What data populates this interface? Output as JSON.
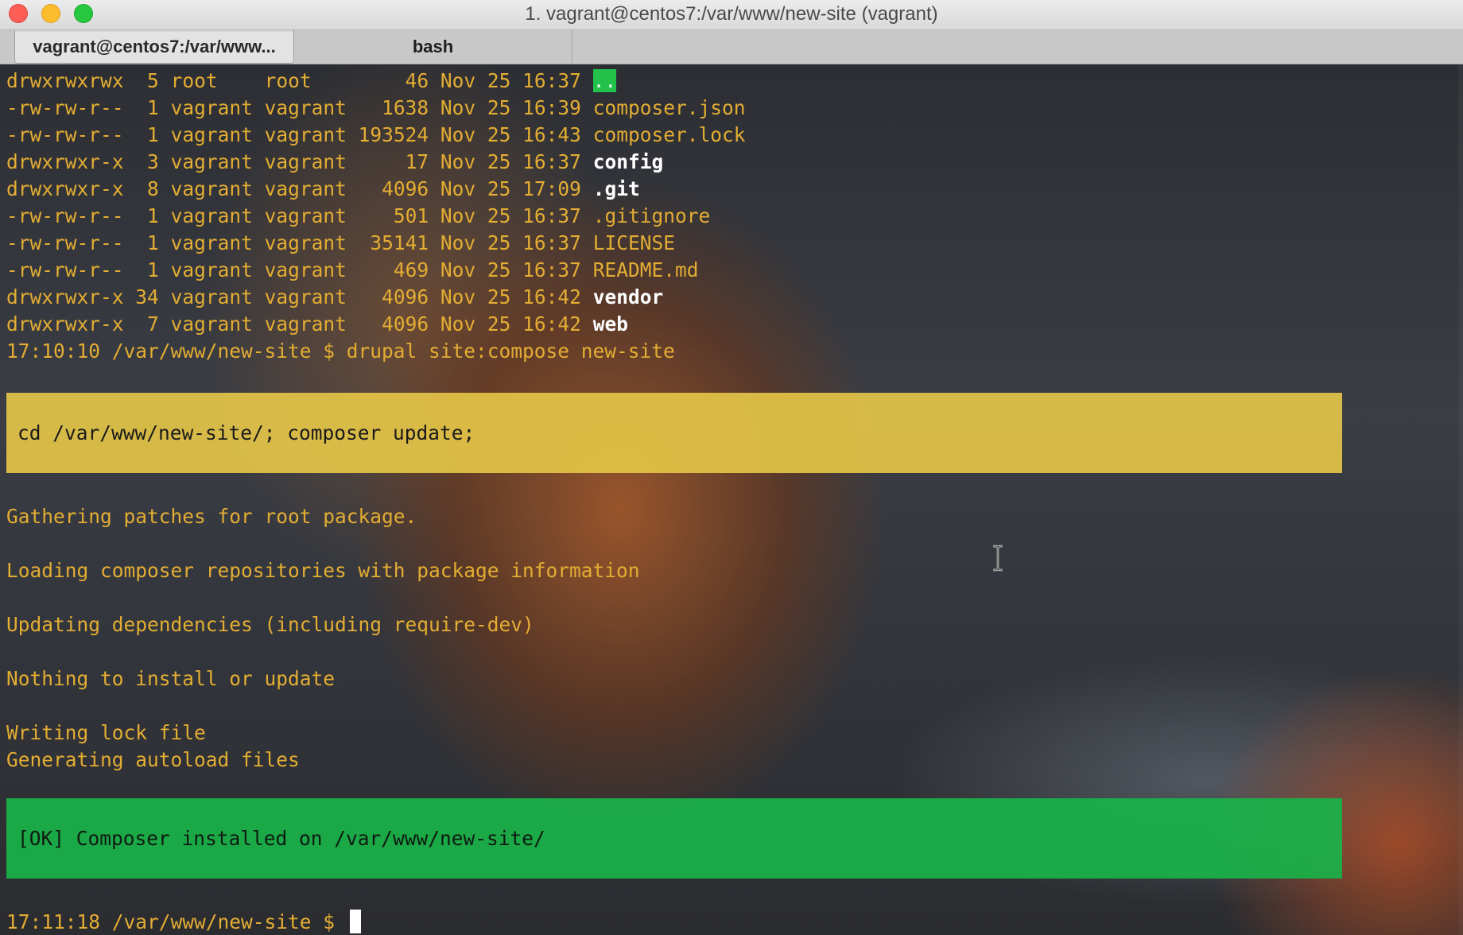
{
  "window": {
    "title": "1. vagrant@centos7:/var/www/new-site (vagrant)"
  },
  "tabs": [
    {
      "label": "vagrant@centos7:/var/www..."
    },
    {
      "label": "bash"
    }
  ],
  "listing": [
    {
      "perms": "drwxrwxrwx",
      "links": " 5",
      "owner": "root   ",
      "group": "root   ",
      "size": "    46",
      "date": "Nov 25 16:37",
      "name": "..",
      "kind": "dotdot"
    },
    {
      "perms": "-rw-rw-r--",
      "links": " 1",
      "owner": "vagrant",
      "group": "vagrant",
      "size": "  1638",
      "date": "Nov 25 16:39",
      "name": "composer.json",
      "kind": "file"
    },
    {
      "perms": "-rw-rw-r--",
      "links": " 1",
      "owner": "vagrant",
      "group": "vagrant",
      "size": "193524",
      "date": "Nov 25 16:43",
      "name": "composer.lock",
      "kind": "file"
    },
    {
      "perms": "drwxrwxr-x",
      "links": " 3",
      "owner": "vagrant",
      "group": "vagrant",
      "size": "    17",
      "date": "Nov 25 16:37",
      "name": "config",
      "kind": "dir"
    },
    {
      "perms": "drwxrwxr-x",
      "links": " 8",
      "owner": "vagrant",
      "group": "vagrant",
      "size": "  4096",
      "date": "Nov 25 17:09",
      "name": ".git",
      "kind": "dir"
    },
    {
      "perms": "-rw-rw-r--",
      "links": " 1",
      "owner": "vagrant",
      "group": "vagrant",
      "size": "   501",
      "date": "Nov 25 16:37",
      "name": ".gitignore",
      "kind": "file"
    },
    {
      "perms": "-rw-rw-r--",
      "links": " 1",
      "owner": "vagrant",
      "group": "vagrant",
      "size": " 35141",
      "date": "Nov 25 16:37",
      "name": "LICENSE",
      "kind": "file"
    },
    {
      "perms": "-rw-rw-r--",
      "links": " 1",
      "owner": "vagrant",
      "group": "vagrant",
      "size": "   469",
      "date": "Nov 25 16:37",
      "name": "README.md",
      "kind": "file"
    },
    {
      "perms": "drwxrwxr-x",
      "links": "34",
      "owner": "vagrant",
      "group": "vagrant",
      "size": "  4096",
      "date": "Nov 25 16:42",
      "name": "vendor",
      "kind": "dir"
    },
    {
      "perms": "drwxrwxr-x",
      "links": " 7",
      "owner": "vagrant",
      "group": "vagrant",
      "size": "  4096",
      "date": "Nov 25 16:42",
      "name": "web",
      "kind": "dir"
    }
  ],
  "command_line": "17:10:10 /var/www/new-site $ drupal site:compose new-site",
  "warn_banner": "cd /var/www/new-site/; composer update;",
  "output": {
    "gathering": "Gathering patches for root package.",
    "loading": "Loading composer repositories with package information",
    "updating": "Updating dependencies (including require-dev)",
    "nothing": "Nothing to install or update",
    "writing": "Writing lock file",
    "generating": "Generating autoload files"
  },
  "ok_banner": "[OK] Composer installed on /var/www/new-site/",
  "prompt": "17:11:18 /var/www/new-site $ ",
  "colors": {
    "terminal_text": "#e3ad33",
    "warn_banner_bg": "#e4c448",
    "ok_banner_bg": "#1ab248",
    "dotdot_bg": "#22c24a"
  }
}
